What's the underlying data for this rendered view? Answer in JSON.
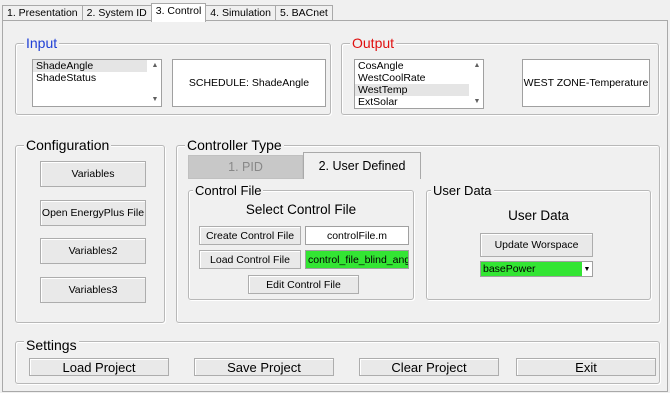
{
  "tabs": [
    {
      "label": "1. Presentation"
    },
    {
      "label": "2. System ID"
    },
    {
      "label": "3. Control"
    },
    {
      "label": "4. Simulation"
    },
    {
      "label": "5. BACnet"
    }
  ],
  "input": {
    "title": "Input",
    "items": [
      "ShadeAngle",
      "ShadeStatus"
    ],
    "selected": "ShadeAngle",
    "display": "SCHEDULE: ShadeAngle"
  },
  "output": {
    "title": "Output",
    "items": [
      "CosAngle",
      "WestCoolRate",
      "WestTemp",
      "ExtSolar"
    ],
    "selected": "WestTemp",
    "display": "WEST ZONE-Temperature"
  },
  "configuration": {
    "title": "Configuration",
    "buttons": [
      "Variables",
      "Open EnergyPlus File",
      "Variables2",
      "Variables3"
    ]
  },
  "controller": {
    "title": "Controller Type",
    "tabs": [
      "1. PID",
      "2. User Defined"
    ],
    "control_file": {
      "title": "Control File",
      "heading": "Select Control File",
      "create_label": "Create Control File",
      "create_value": "controlFile.m",
      "load_label": "Load Control File",
      "load_value": "control_file_blind_angl",
      "edit_label": "Edit Control File"
    },
    "user_data": {
      "title": "User Data",
      "heading": "User Data",
      "update_label": "Update Worspace",
      "selected": "basePower"
    }
  },
  "settings": {
    "title": "Settings",
    "buttons": [
      "Load Project",
      "Save Project",
      "Clear Project",
      "Exit"
    ]
  },
  "colors": {
    "input_title": "#1f3fd6",
    "output_title": "#e01010",
    "green_field": "#33e533"
  },
  "icons": {
    "scroll_up": "▲",
    "scroll_down": "▼",
    "dropdown": "▼"
  }
}
